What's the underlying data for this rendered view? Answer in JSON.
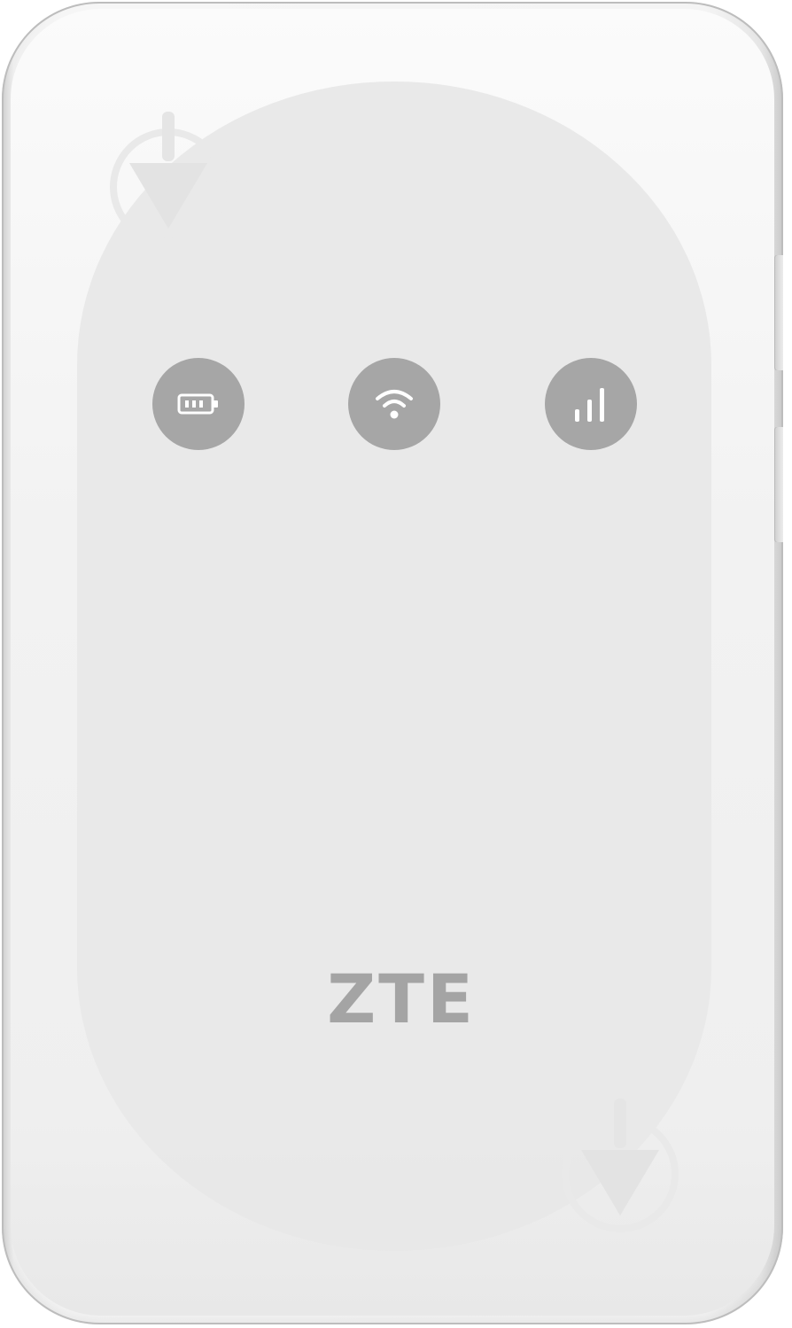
{
  "device": {
    "brand_logo": "ZTE",
    "indicators": [
      {
        "name": "battery",
        "icon": "battery-icon"
      },
      {
        "name": "wifi",
        "icon": "wifi-icon"
      },
      {
        "name": "signal",
        "icon": "signal-bars-icon"
      }
    ]
  },
  "colors": {
    "body": "#f4f4f4",
    "panel": "#e8e8e8",
    "indicator": "#a6a6a6",
    "logo": "#a4a4a4"
  }
}
